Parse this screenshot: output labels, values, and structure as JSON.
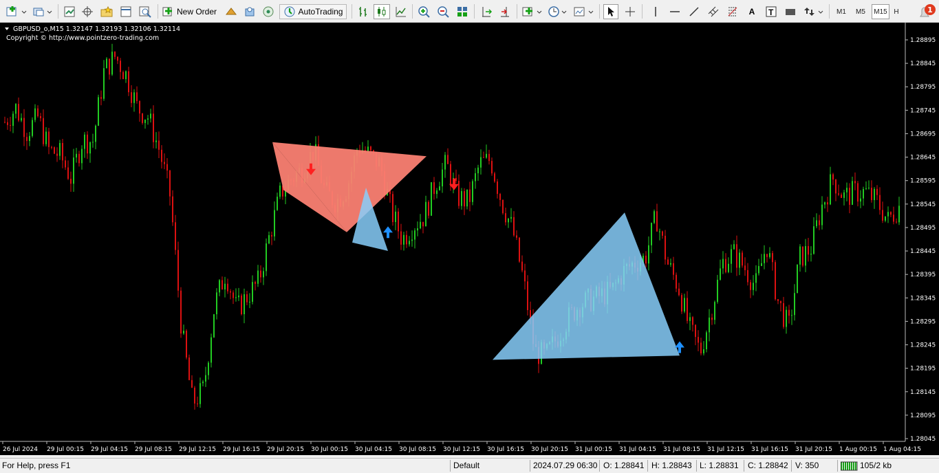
{
  "toolbar": {
    "new_order_label": "New Order",
    "autotrading_label": "AutoTrading",
    "timeframes": [
      "M1",
      "M5",
      "M15",
      "H"
    ],
    "active_timeframe": "M15",
    "notification_count": "1"
  },
  "chart": {
    "header": "GBPUSD_o,M15  1.32147 1.32193 1.32106 1.32114",
    "copyright": "Copyright © http://www.pointzero-trading.com",
    "price_labels": [
      "1.28895",
      "1.28845",
      "1.28795",
      "1.28745",
      "1.28695",
      "1.28645",
      "1.28595",
      "1.28545",
      "1.28495",
      "1.28445",
      "1.28395",
      "1.28345",
      "1.28295",
      "1.28245",
      "1.28195",
      "1.28145",
      "1.28095",
      "1.28045"
    ],
    "time_labels": [
      "26 Jul 2024",
      "29 Jul 00:15",
      "29 Jul 04:15",
      "29 Jul 08:15",
      "29 Jul 12:15",
      "29 Jul 16:15",
      "29 Jul 20:15",
      "30 Jul 00:15",
      "30 Jul 04:15",
      "30 Jul 08:15",
      "30 Jul 12:15",
      "30 Jul 16:15",
      "30 Jul 20:15",
      "31 Jul 00:15",
      "31 Jul 04:15",
      "31 Jul 08:15",
      "31 Jul 12:15",
      "31 Jul 16:15",
      "31 Jul 20:15",
      "1 Aug 00:15",
      "1 Aug 04:15"
    ],
    "colors": {
      "background": "#000000",
      "bull": "#22cc22",
      "bear": "#dd1111",
      "bearish_pattern": "#fa8072",
      "bullish_pattern": "#87cefa",
      "sell_arrow": "#ff2020",
      "buy_arrow": "#1e90ff"
    },
    "price_path": [
      1.2872,
      1.2875,
      1.287,
      1.2873,
      1.2866,
      1.2865,
      1.286,
      1.2868,
      1.2868,
      1.2883,
      1.2886,
      1.2882,
      1.2875,
      1.2873,
      1.2866,
      1.2856,
      1.2828,
      1.2812,
      1.2815,
      1.2833,
      1.284,
      1.2832,
      1.2835,
      1.2838,
      1.2848,
      1.2857,
      1.286,
      1.2862,
      1.2866,
      1.2857,
      1.2855,
      1.2858,
      1.2867,
      1.2865,
      1.2863,
      1.2853,
      1.2847,
      1.285,
      1.2852,
      1.2859,
      1.2863,
      1.2856,
      1.2855,
      1.2863,
      1.2864,
      1.2855,
      1.2849,
      1.2838,
      1.2823,
      1.2822,
      1.2826,
      1.283,
      1.2833,
      1.2834,
      1.2835,
      1.2836,
      1.284,
      1.2842,
      1.2843,
      1.2852,
      1.2842,
      1.2837,
      1.2828,
      1.2823,
      1.2832,
      1.2842,
      1.2844,
      1.2841,
      1.2837,
      1.2846,
      1.2834,
      1.2828,
      1.2843,
      1.2845,
      1.2854,
      1.286,
      1.2856,
      1.2857,
      1.2857,
      1.2855,
      1.2851,
      1.2854
    ],
    "patterns": [
      {
        "kind": "bearish",
        "points": [
          {
            "time": "29 Jul 20:45",
            "price": 1.28677
          },
          {
            "time": "29 Jul 21:45",
            "price": 1.28575
          },
          {
            "time": "30 Jul 10:45",
            "price": 1.28647
          },
          {
            "time": "30 Jul 03:30",
            "price": 1.28485
          }
        ]
      },
      {
        "kind": "bullish",
        "points": [
          {
            "time": "30 Jul 04:00",
            "price": 1.28463
          },
          {
            "time": "30 Jul 05:15",
            "price": 1.2858
          },
          {
            "time": "30 Jul 07:15",
            "price": 1.28445
          }
        ]
      },
      {
        "kind": "bullish",
        "points": [
          {
            "time": "30 Jul 16:45",
            "price": 1.28213
          },
          {
            "time": "31 Jul 04:45",
            "price": 1.28527
          },
          {
            "time": "31 Jul 09:45",
            "price": 1.28222
          }
        ]
      }
    ],
    "arrows": [
      {
        "direction": "sell",
        "time": "30 Jul 00:15",
        "price": 1.28611
      },
      {
        "direction": "buy",
        "time": "30 Jul 07:15",
        "price": 1.28493
      },
      {
        "direction": "sell",
        "time": "30 Jul 13:15",
        "price": 1.28579
      },
      {
        "direction": "buy",
        "time": "31 Jul 09:45",
        "price": 1.28248
      }
    ]
  },
  "status": {
    "help": "For Help, press F1",
    "profile": "Default",
    "datetime": "2024.07.29 06:30",
    "open": "O: 1.28841",
    "high": "H: 1.28843",
    "low": "L: 1.28831",
    "close": "C: 1.28842",
    "volume": "V: 350",
    "traffic": "105/2 kb"
  }
}
